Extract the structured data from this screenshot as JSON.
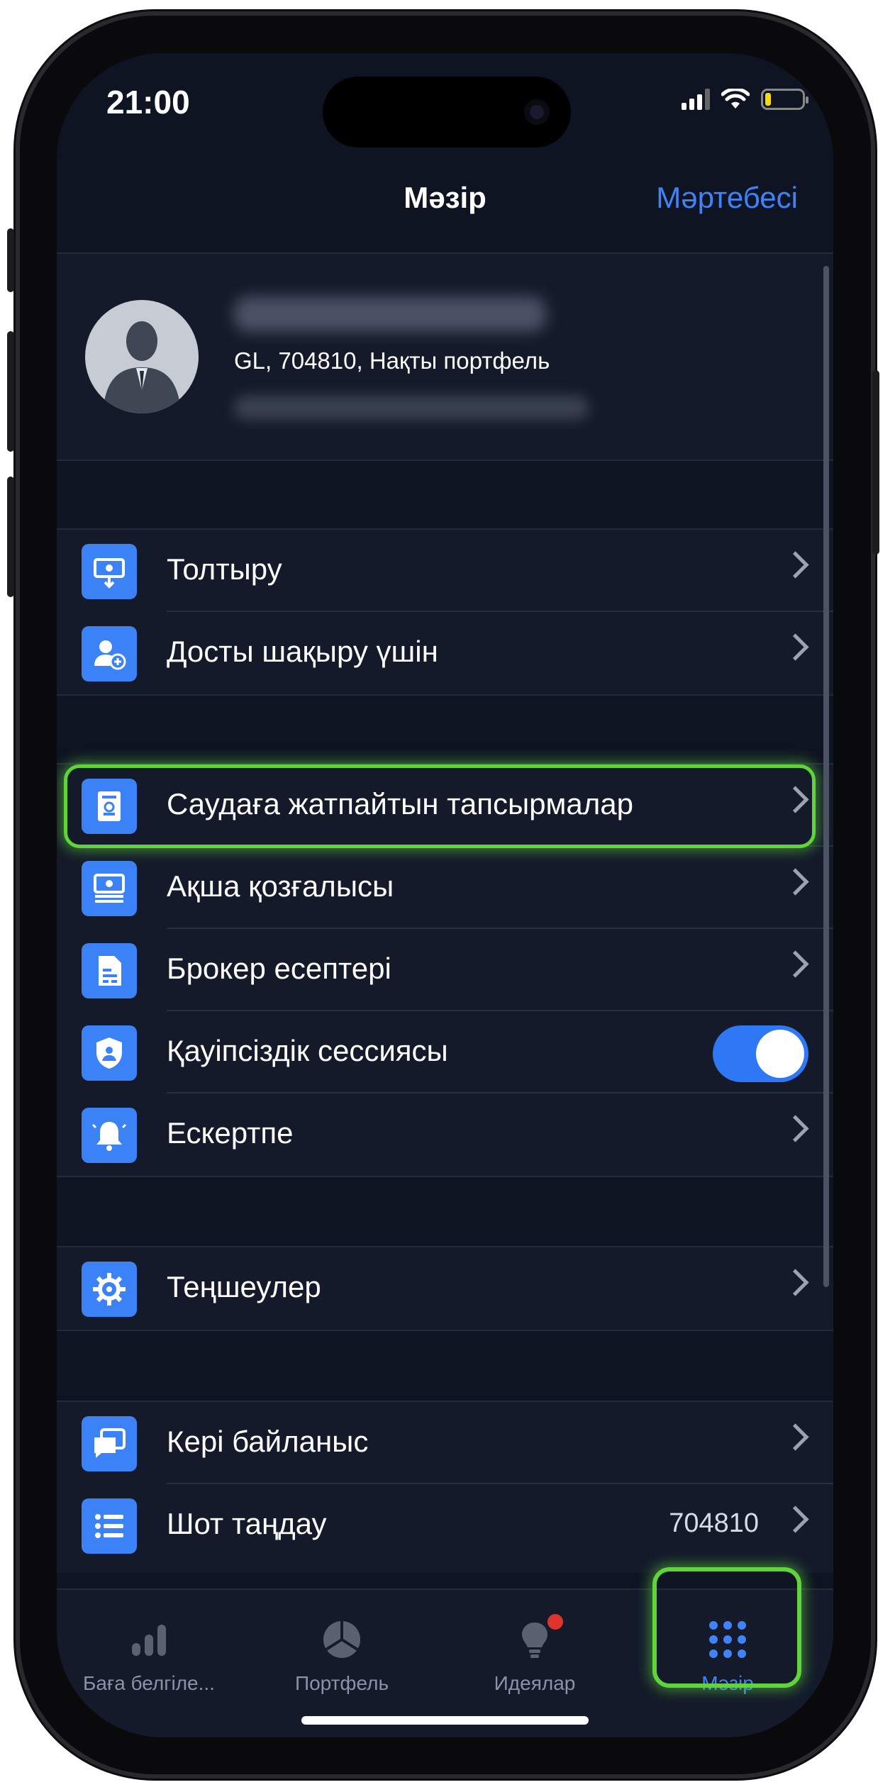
{
  "status_bar": {
    "time": "21:00"
  },
  "nav": {
    "title": "Мәзір",
    "right_link": "Мәртебесі"
  },
  "profile": {
    "account_info": "GL, 704810, Нақты портфель"
  },
  "sections": {
    "group1": [
      {
        "label": "Толтыру",
        "icon": "deposit-icon"
      },
      {
        "label": "Досты шақыру үшін",
        "icon": "add-user-icon"
      }
    ],
    "group2": [
      {
        "label": "Саудаға жатпайтын тапсырмалар",
        "icon": "document-stamp-icon"
      },
      {
        "label": "Ақша қозғалысы",
        "icon": "money-flow-icon"
      },
      {
        "label": "Брокер есептері",
        "icon": "report-icon"
      },
      {
        "label": "Қауіпсіздік сессиясы",
        "icon": "shield-icon",
        "toggle": true
      },
      {
        "label": "Ескертпе",
        "icon": "bell-icon"
      }
    ],
    "group3": [
      {
        "label": "Теңшеулер",
        "icon": "gear-icon"
      }
    ],
    "group4": [
      {
        "label": "Кері байланыс",
        "icon": "chat-icon"
      },
      {
        "label": "Шот таңдау",
        "icon": "list-icon",
        "value": "704810"
      }
    ]
  },
  "tabs": [
    {
      "label": "Баға белгіле...",
      "icon": "bar-chart-icon"
    },
    {
      "label": "Портфель",
      "icon": "pie-chart-icon"
    },
    {
      "label": "Идеялар",
      "icon": "lightbulb-icon"
    },
    {
      "label": "Мәзір",
      "icon": "grid-dots-icon"
    }
  ],
  "colors": {
    "accent": "#3f83f8",
    "highlight": "#5fd43b",
    "background": "#0f1423"
  }
}
